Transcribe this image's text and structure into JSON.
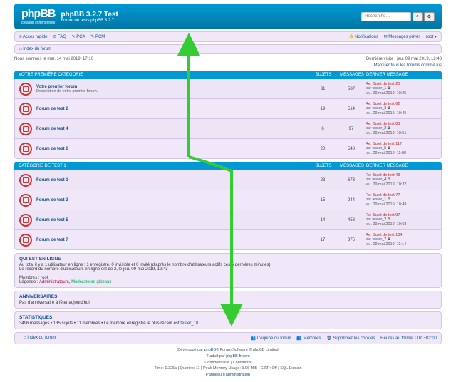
{
  "header": {
    "title": "phpBB 3.2.7 Test",
    "desc": "Forum de tests phpBB 3.2.7",
    "logo": "phpBB",
    "logo_sub": "creating communities"
  },
  "search": {
    "placeholder": "Recherche…",
    "go": "⌕",
    "adv": "⚙"
  },
  "nav": {
    "quick": "≡ Accès rapide",
    "faq": "⊙ FAQ",
    "pca": "✎ PCA",
    "pcm": "✎ PCM",
    "notif": "🔔 Notifications",
    "pm": "✉ Messages privés",
    "user": "root ▾"
  },
  "breadcrumb": {
    "home": "⌂ Index du forum"
  },
  "time": {
    "now": "Nous sommes le mar. 14 mai 2019, 17:10",
    "last": "Dernière visite : jeu. 09 mai 2019, 12:43"
  },
  "mark": "Marquer tous les forums comme lus",
  "cols": {
    "topics": "SUJETS",
    "posts": "MESSAGES",
    "last": "DERNIER MESSAGE"
  },
  "cat1": {
    "name": "VOTRE PREMIÈRE CATÉGORIE",
    "forums": [
      {
        "name": "Votre premier forum",
        "desc": "Description de votre premier forum.",
        "t": "31",
        "p": "587",
        "lp": {
          "t": "Re: Sujet de test 20",
          "u": "tester_1",
          "d": "jeu. 09 mai 2019, 10:25"
        }
      },
      {
        "name": "Forum de test 2",
        "desc": "",
        "t": "19",
        "p": "514",
        "lp": {
          "t": "Re: Sujet de test 62",
          "u": "tester_3",
          "d": "jeu. 09 mai 2019, 10:45"
        }
      },
      {
        "name": "Forum de test 4",
        "desc": "",
        "t": "6",
        "p": "97",
        "lp": {
          "t": "Re: Sujet de test 83",
          "u": "tester_2",
          "d": "jeu. 09 mai 2019, 10:51"
        }
      },
      {
        "name": "Forum de test 6",
        "desc": "",
        "t": "20",
        "p": "548",
        "lp": {
          "t": "Re: Sujet de test 117",
          "u": "tester_5",
          "d": "jeu. 09 mai 2019, 11:08"
        }
      }
    ]
  },
  "cat2": {
    "name": "CATÉGORIE DE TEST 1",
    "forums": [
      {
        "name": "Forum de test 1",
        "desc": "",
        "t": "23",
        "p": "673",
        "lp": {
          "t": "Re: Sujet de test 43",
          "u": "tester_4",
          "d": "jeu. 09 mai 2019, 10:37"
        }
      },
      {
        "name": "Forum de test 3",
        "desc": "",
        "t": "15",
        "p": "244",
        "lp": {
          "t": "Re: Sujet de test 77",
          "u": "tester_1",
          "d": "jeu. 09 mai 2019, 10:49"
        }
      },
      {
        "name": "Forum de test 5",
        "desc": "",
        "t": "14",
        "p": "458",
        "lp": {
          "t": "Re: Sujet de test 97",
          "u": "tester_2",
          "d": "jeu. 09 mai 2019, 10:58"
        }
      },
      {
        "name": "Forum de test 7",
        "desc": "",
        "t": "17",
        "p": "375",
        "lp": {
          "t": "Re: Sujet de test 134",
          "u": "tester_7",
          "d": "jeu. 09 mai 2019, 11:14"
        }
      }
    ]
  },
  "online": {
    "h": "QUI EST EN LIGNE",
    "l1": "Au total il y a 1 utilisateur en ligne : 1 enregistré, 0 invisible et 0 invité (d'après le nombre d'utilisateurs actifs ces 5 dernières minutes)",
    "l2": "Le record du nombre d'utilisateurs en ligne est de 2, le jeu. 09 mai 2019, 12:43",
    "l3": "Membres : ",
    "user": "root",
    "l4": "Légende : ",
    "adm": "Administrateurs",
    "mod": "Modérateurs globaux"
  },
  "bday": {
    "h": "ANNIVERSAIRES",
    "l": "Pas d'anniversaire à fêter aujourd'hui"
  },
  "stats": {
    "h": "STATISTIQUES",
    "l": "3496 messages • 135 sujets • 11 membres • Le membre enregistré le plus récent est ",
    "u": "tester_10"
  },
  "footer": {
    "home": "⌂ Index du forum",
    "team": "👥 L'équipe du forum",
    "members": "👥 Membres",
    "cookies": "🗑 Supprimer les cookies",
    "tz": "Heures au format UTC+02:00"
  },
  "credits": {
    "l1a": "Développé par ",
    "l1b": "phpBB",
    "l1c": "® Forum Software © phpBB Limited",
    "l2a": "Traduit par ",
    "l2b": "phpBB-fr.com",
    "l3": "Confidentialité | Conditions",
    "l4": "Time: 0.325s | Queries: 11 | Peak Memory Usage: 9.96 MiB | GZIP: Off | SQL Explain",
    "l5": "Panneau d'administration"
  }
}
